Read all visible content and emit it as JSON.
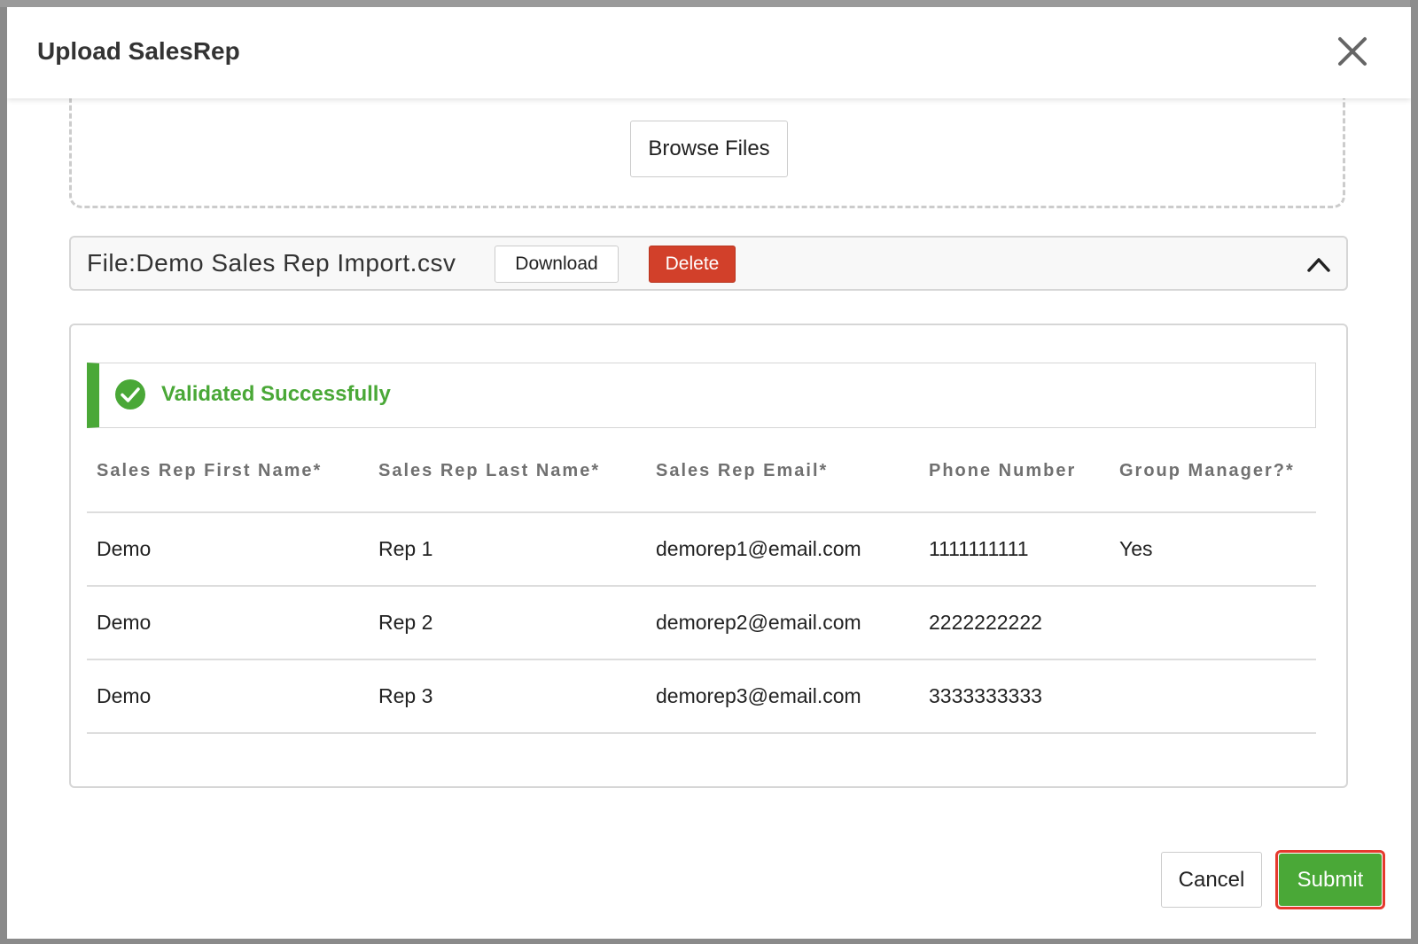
{
  "modal": {
    "title": "Upload SalesRep",
    "close_icon": "close-icon"
  },
  "dropzone": {
    "browse_label": "Browse Files"
  },
  "file": {
    "name_label": "File:Demo Sales Rep Import.csv",
    "download_label": "Download",
    "delete_label": "Delete",
    "collapse_icon": "chevron-up-icon"
  },
  "validation": {
    "icon": "check-circle-icon",
    "message": "Validated Successfully"
  },
  "table": {
    "headers": [
      "Sales Rep First Name*",
      "Sales Rep Last Name*",
      "Sales Rep Email*",
      "Phone Number",
      "Group Manager?*"
    ],
    "rows": [
      {
        "first": "Demo",
        "last": "Rep 1",
        "email": "demorep1@email.com",
        "phone": "1111111111",
        "group_manager": "Yes"
      },
      {
        "first": "Demo",
        "last": "Rep 2",
        "email": "demorep2@email.com",
        "phone": "2222222222",
        "group_manager": ""
      },
      {
        "first": "Demo",
        "last": "Rep 3",
        "email": "demorep3@email.com",
        "phone": "3333333333",
        "group_manager": ""
      }
    ]
  },
  "footer": {
    "cancel_label": "Cancel",
    "submit_label": "Submit"
  },
  "colors": {
    "success": "#4aa837",
    "danger": "#d2402a",
    "highlight_outline": "#e53a2e"
  }
}
